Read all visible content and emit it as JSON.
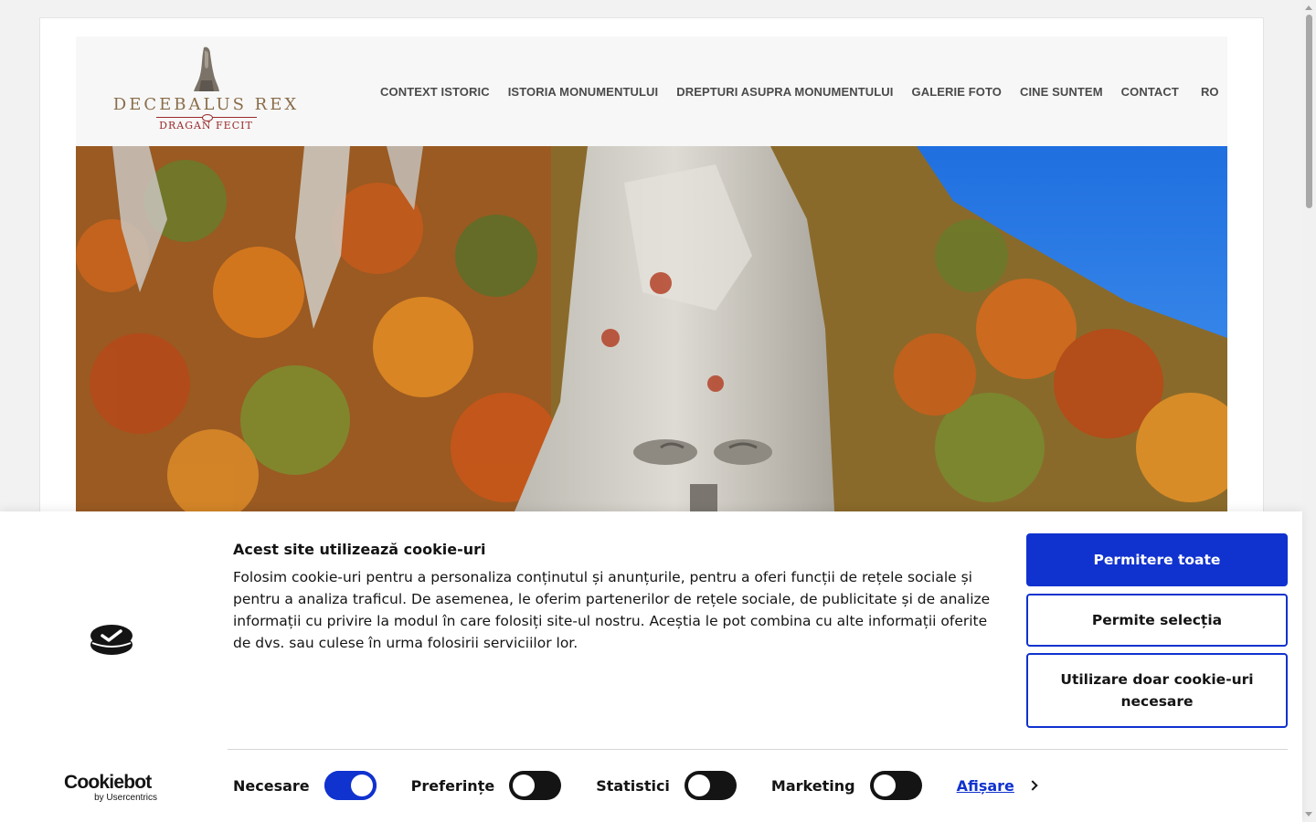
{
  "header": {
    "logo": {
      "title": "DECEBALUS REX",
      "subtitle": "DRAGAN FECIT"
    },
    "nav": {
      "items": [
        {
          "label": "CONTEXT ISTORIC"
        },
        {
          "label": "ISTORIA MONUMENTULUI"
        },
        {
          "label": "DREPTURI ASUPRA MONUMENTULUI"
        },
        {
          "label": "GALERIE FOTO"
        },
        {
          "label": "CINE SUNTEM"
        },
        {
          "label": "CONTACT"
        }
      ],
      "language": "RO"
    }
  },
  "cookie_banner": {
    "title": "Acest site utilizează cookie-uri",
    "text": "Folosim cookie-uri pentru a personaliza conținutul și anunțurile, pentru a oferi funcții de rețele sociale și pentru a analiza traficul. De asemenea, le oferim partenerilor de rețele sociale, de publicitate și de analize informații cu privire la modul în care folosiți site-ul nostru. Aceștia le pot combina cu alte informații oferite de dvs. sau culese în urma folosirii serviciilor lor.",
    "buttons": {
      "allow_all": "Permitere toate",
      "allow_selection": "Permite selecția",
      "necessary_only": "Utilizare doar cookie-uri necesare"
    },
    "brand": {
      "name": "Cookiebot",
      "by": "by Usercentrics"
    },
    "toggles": [
      {
        "label": "Necesare",
        "checked": true
      },
      {
        "label": "Preferințe",
        "checked": false
      },
      {
        "label": "Statistici",
        "checked": false
      },
      {
        "label": "Marketing",
        "checked": false
      }
    ],
    "show_details": "Afișare"
  },
  "colors": {
    "accent": "#1032cf",
    "logo_gold": "#8a6d4a",
    "logo_red": "#9a2a2a"
  }
}
